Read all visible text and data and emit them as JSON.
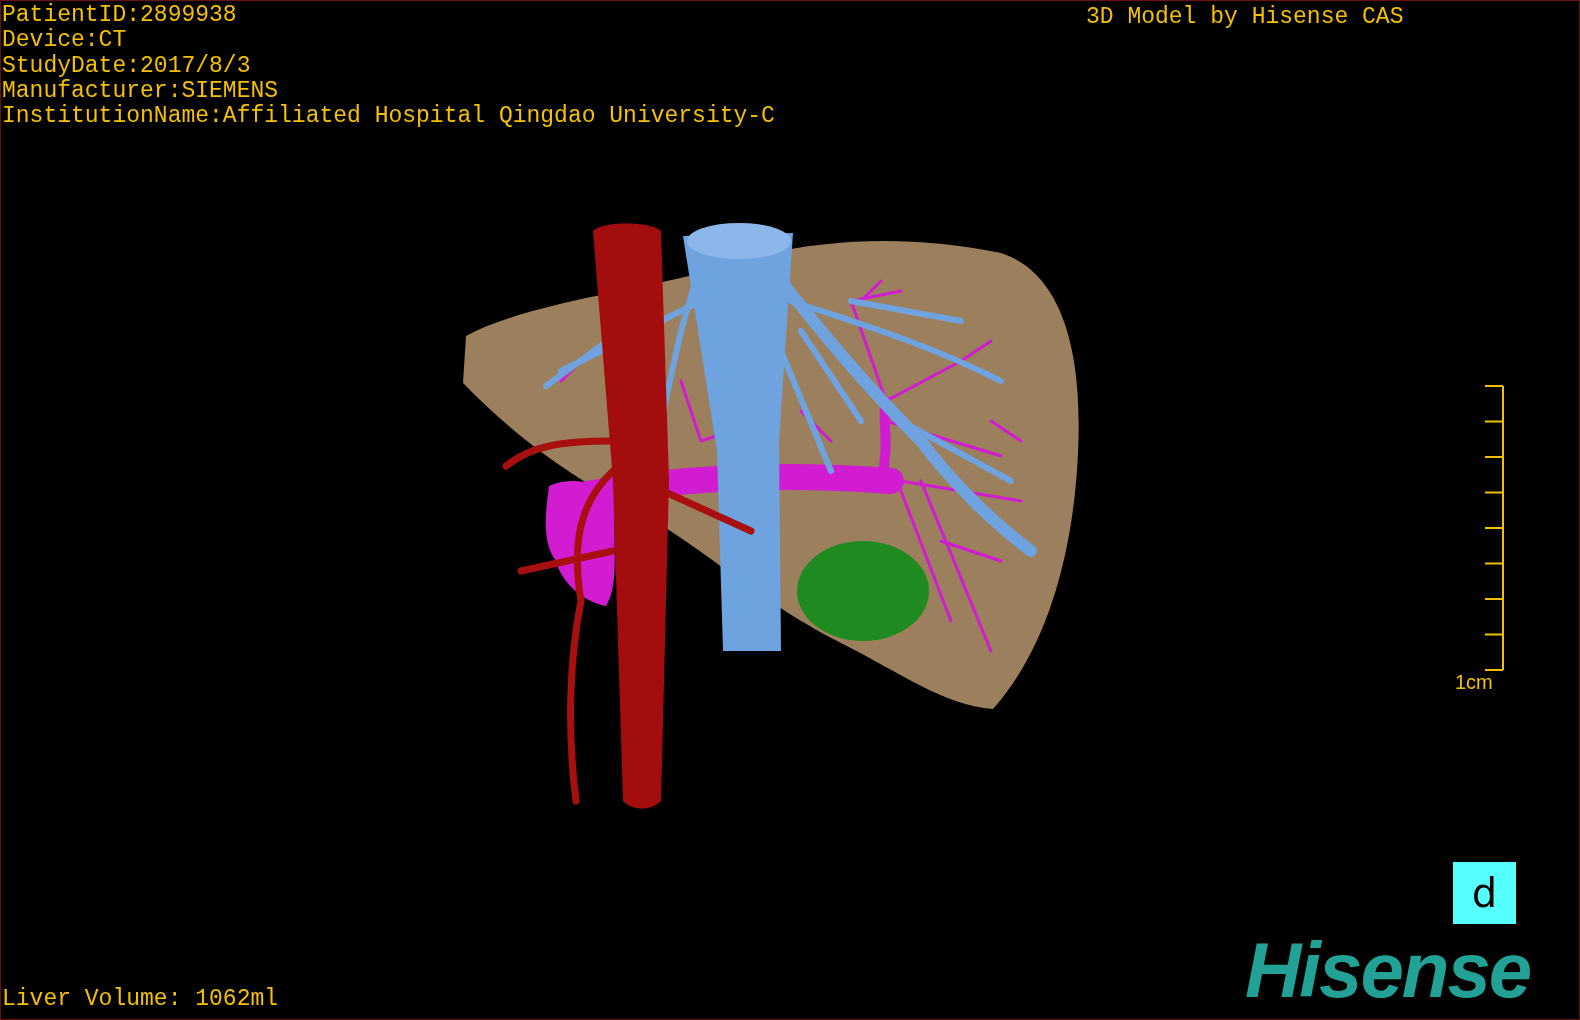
{
  "patient_info": [
    "PatientID:2899938",
    "Device:CT",
    "StudyDate:2017/8/3",
    "Manufacturer:SIEMENS",
    "InstitutionName:Affiliated Hospital Qingdao University-C"
  ],
  "model_credit": "3D Model by Hisense CAS",
  "scale_bar": {
    "label": "1cm"
  },
  "orientation_marker": "d",
  "liver_volume": "Liver Volume: 1062ml",
  "logo": "Hisense"
}
